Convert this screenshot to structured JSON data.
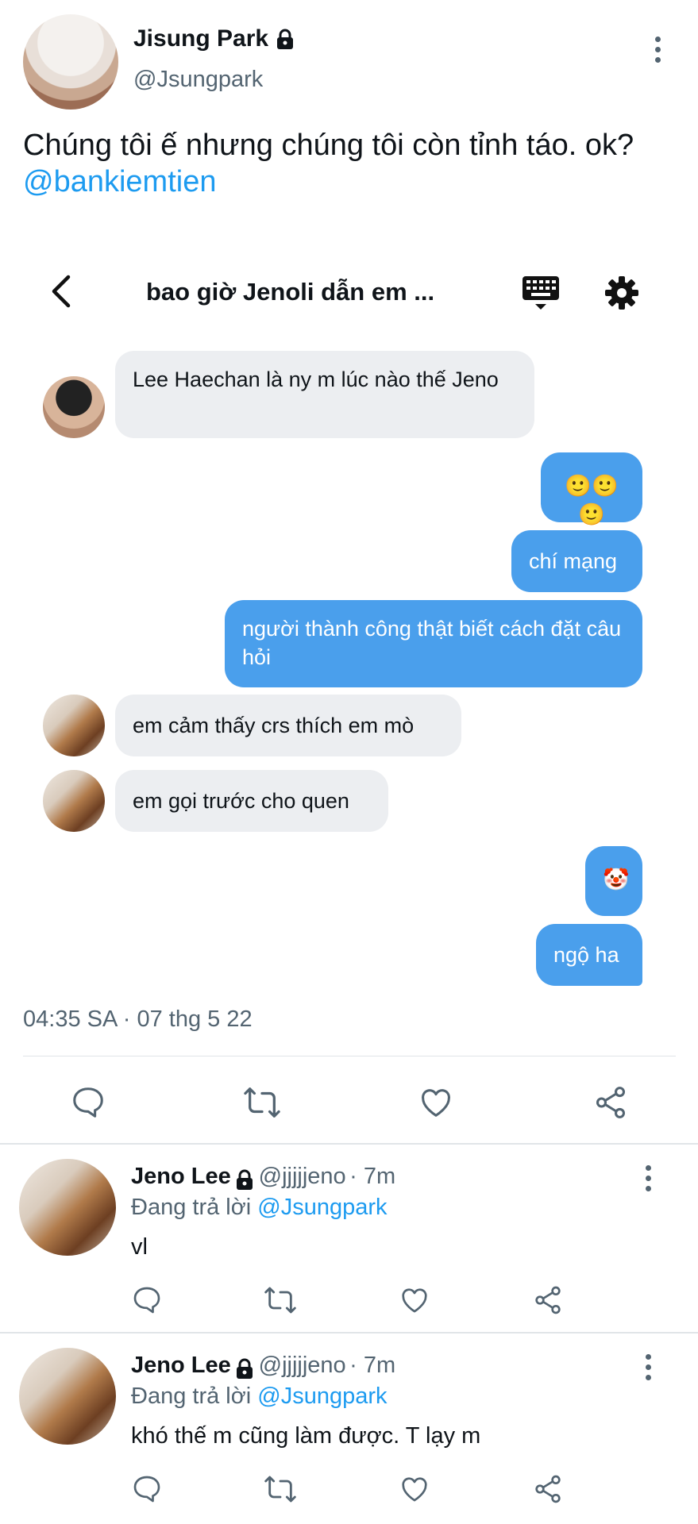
{
  "tweet": {
    "author_name": "Jisung Park",
    "author_handle": "@Jsungpark",
    "text": "Chúng tôi ế nhưng chúng tôi còn tỉnh táo. ok?",
    "mention": "@bankiemtien",
    "timestamp": "04:35 SA · 07 thg 5 22"
  },
  "dm": {
    "title": "bao giờ Jenoli dẫn em ...",
    "messages": [
      {
        "from": "other",
        "text": "Lee Haechan là ny m lúc nào thế Jeno"
      },
      {
        "from": "me",
        "text": "🙂🙂🙂"
      },
      {
        "from": "me",
        "text": "chí mạng"
      },
      {
        "from": "me",
        "text": "người thành công thật biết cách đặt câu hỏi"
      },
      {
        "from": "other",
        "text": "em cảm thấy crs thích em mò"
      },
      {
        "from": "other",
        "text": "em gọi trước cho quen"
      },
      {
        "from": "me",
        "text": "🤡"
      },
      {
        "from": "me",
        "text": "ngộ ha"
      }
    ]
  },
  "replies": [
    {
      "name": "Jeno Lee",
      "handle": "@jjjjjeno",
      "time": "· 7m",
      "replying_label": "Đang trả lời",
      "replying_to": "@Jsungpark",
      "text": "vl"
    },
    {
      "name": "Jeno Lee",
      "handle": "@jjjjjeno",
      "time": "· 7m",
      "replying_label": "Đang trả lời",
      "replying_to": "@Jsungpark",
      "text": "khó thế m cũng làm được. T lạy m"
    }
  ],
  "icons": [
    "lock-icon",
    "more-icon",
    "back-arrow-icon",
    "keyboard-icon",
    "gear-icon",
    "reply-icon",
    "retweet-icon",
    "like-icon",
    "share-icon"
  ],
  "colors": {
    "accent": "#1d9bf0",
    "dm_bubble_out": "#4a9fec",
    "dm_bubble_in": "#eceef1"
  }
}
